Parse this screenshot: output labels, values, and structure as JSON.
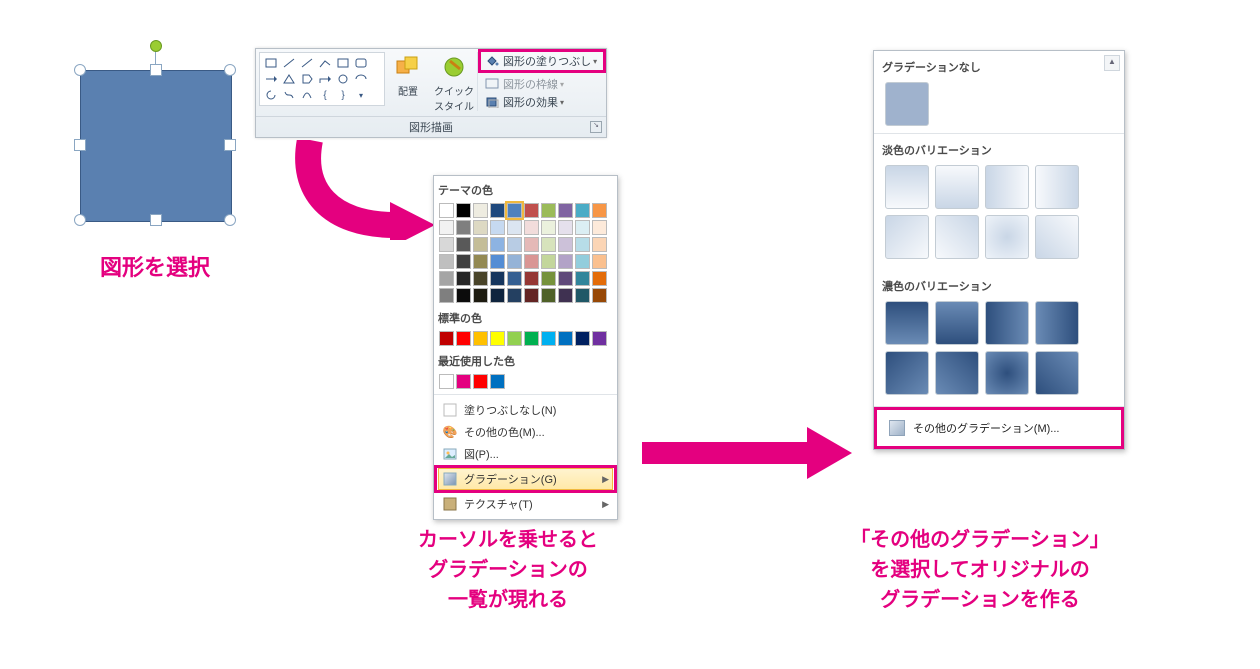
{
  "step1_label": "図形を選択",
  "ribbon": {
    "group_label": "図形描画",
    "arrange_label": "配置",
    "quickstyle_label": "クイック\nスタイル",
    "fill_label": "図形の塗りつぶし",
    "outline_label": "図形の枠線",
    "effects_label": "図形の効果"
  },
  "fill_menu": {
    "theme_header": "テーマの色",
    "standard_header": "標準の色",
    "recent_header": "最近使用した色",
    "no_fill": "塗りつぶしなし(N)",
    "more_colors": "その他の色(M)...",
    "picture": "図(P)...",
    "gradient": "グラデーション(G)",
    "texture": "テクスチャ(T)",
    "theme_top": [
      "#ffffff",
      "#000000",
      "#eeece1",
      "#1f497d",
      "#4f81bd",
      "#c0504d",
      "#9bbb59",
      "#8064a2",
      "#4bacc6",
      "#f79646"
    ],
    "theme_shades": [
      [
        "#f2f2f2",
        "#7f7f7f",
        "#ddd9c3",
        "#c6d9f0",
        "#dbe5f1",
        "#f2dcdb",
        "#ebf1dd",
        "#e5e0ec",
        "#dbeef3",
        "#fdeada"
      ],
      [
        "#d8d8d8",
        "#595959",
        "#c4bd97",
        "#8db3e2",
        "#b8cce4",
        "#e5b9b7",
        "#d7e3bc",
        "#ccc1d9",
        "#b7dde8",
        "#fbd5b5"
      ],
      [
        "#bfbfbf",
        "#3f3f3f",
        "#938953",
        "#548dd4",
        "#95b3d7",
        "#d99694",
        "#c3d69b",
        "#b2a2c7",
        "#92cddc",
        "#fac08f"
      ],
      [
        "#a5a5a5",
        "#262626",
        "#494429",
        "#17365d",
        "#366092",
        "#953734",
        "#76923c",
        "#5f497a",
        "#31859b",
        "#e36c09"
      ],
      [
        "#7f7f7f",
        "#0c0c0c",
        "#1d1b10",
        "#0f243e",
        "#244061",
        "#632423",
        "#4f6128",
        "#3f3151",
        "#205867",
        "#974806"
      ]
    ],
    "standard": [
      "#c00000",
      "#ff0000",
      "#ffc000",
      "#ffff00",
      "#92d050",
      "#00b050",
      "#00b0f0",
      "#0070c0",
      "#002060",
      "#7030a0"
    ],
    "recent": [
      "#ffffff",
      "#e4007f",
      "#ff0000",
      "#0070c0"
    ]
  },
  "grad_panel": {
    "none": "グラデーションなし",
    "light": "淡色のバリエーション",
    "dark": "濃色のバリエーション",
    "more": "その他のグラデーション(M)..."
  },
  "captions": {
    "c2": "カーソルを乗せると\nグラデーションの\n一覧が現れる",
    "c3": "「その他のグラデーション」\nを選択してオリジナルの\nグラデーションを作る"
  }
}
